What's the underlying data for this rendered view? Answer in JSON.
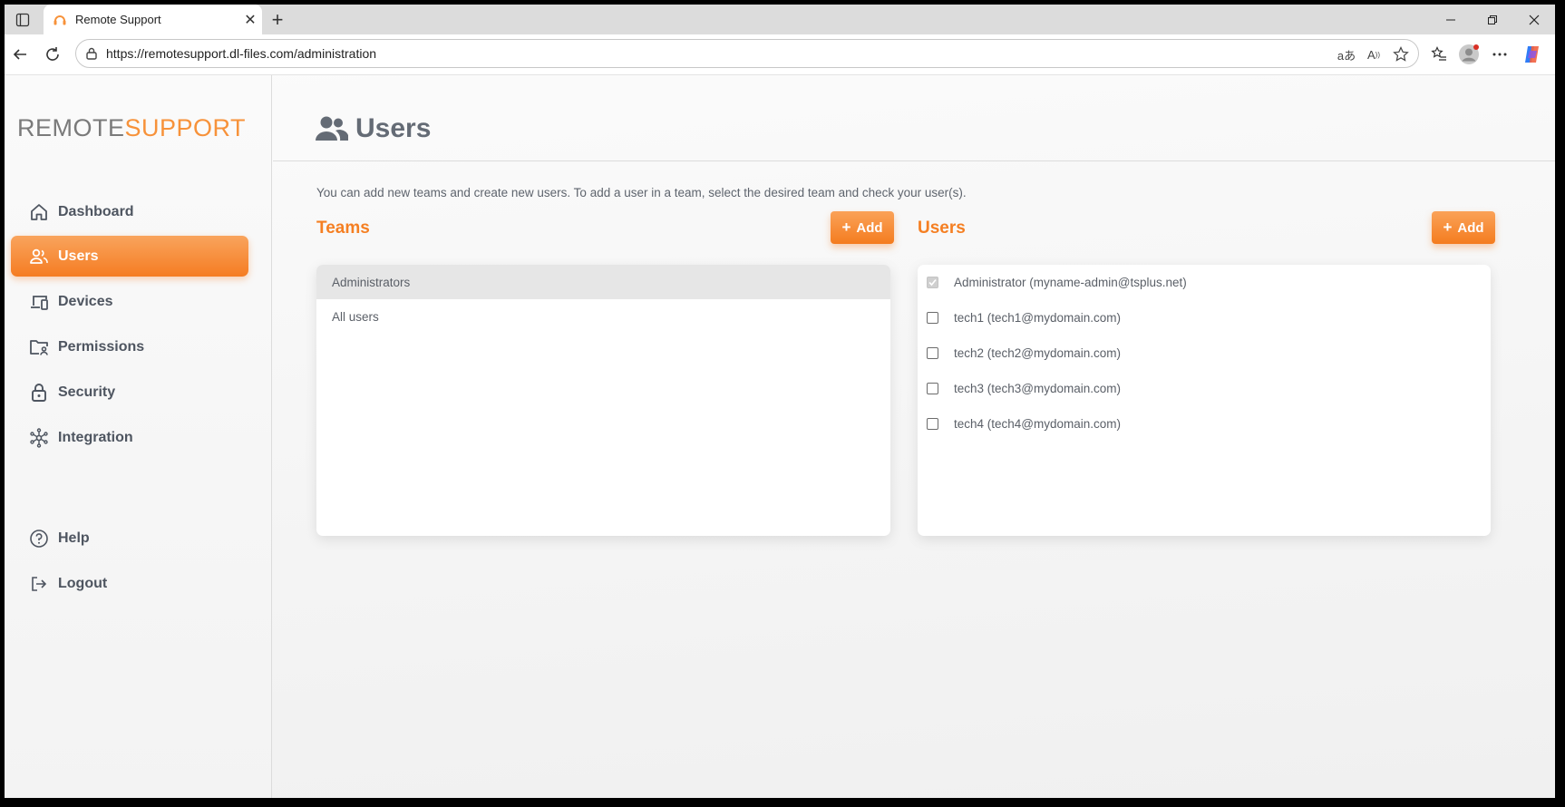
{
  "browser": {
    "tab_title": "Remote Support",
    "tab_close": "✕",
    "new_tab": "+",
    "url": "https://remotesupport.dl-files.com/administration"
  },
  "sidebar": {
    "logo_part1": "REMOTE",
    "logo_part2": "SUPPORT",
    "items": [
      {
        "label": "Dashboard",
        "icon": "home-icon",
        "active": false
      },
      {
        "label": "Users",
        "icon": "users-icon",
        "active": true
      },
      {
        "label": "Devices",
        "icon": "devices-icon",
        "active": false
      },
      {
        "label": "Permissions",
        "icon": "folder-user-icon",
        "active": false
      },
      {
        "label": "Security",
        "icon": "lock-icon",
        "active": false
      },
      {
        "label": "Integration",
        "icon": "network-icon",
        "active": false
      }
    ],
    "bottom_items": [
      {
        "label": "Help",
        "icon": "help-icon"
      },
      {
        "label": "Logout",
        "icon": "logout-icon"
      }
    ]
  },
  "main": {
    "title": "Users",
    "description": "You can add new teams and create new users. To add a user in a team, select the desired team and check your user(s).",
    "teams": {
      "title": "Teams",
      "add_label": "Add",
      "items": [
        {
          "label": "Administrators",
          "selected": true
        },
        {
          "label": "All users",
          "selected": false
        }
      ]
    },
    "users": {
      "title": "Users",
      "add_label": "Add",
      "items": [
        {
          "label": "Administrator (myname-admin@tsplus.net)",
          "checked": true
        },
        {
          "label": "tech1 (tech1@mydomain.com)",
          "checked": false
        },
        {
          "label": "tech2 (tech2@mydomain.com)",
          "checked": false
        },
        {
          "label": "tech3 (tech3@mydomain.com)",
          "checked": false
        },
        {
          "label": "tech4 (tech4@mydomain.com)",
          "checked": false
        }
      ]
    }
  },
  "colors": {
    "accent": "#f57c22",
    "text": "#4e5560"
  }
}
